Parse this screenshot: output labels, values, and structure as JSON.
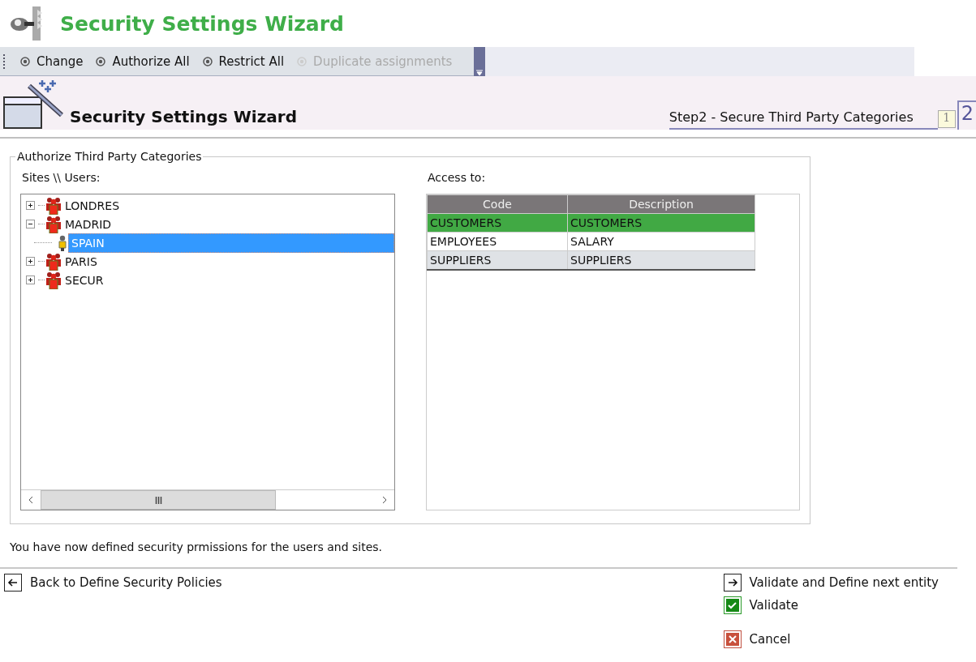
{
  "app_title": "Security Settings Wizard",
  "toolbar": [
    {
      "label": "Change",
      "disabled": false
    },
    {
      "label": "Authorize All",
      "disabled": false
    },
    {
      "label": "Restrict All",
      "disabled": false
    },
    {
      "label": "Duplicate assignments",
      "disabled": true
    }
  ],
  "wizard": {
    "title": "Security Settings Wizard",
    "step_title": "Step2 - Secure Third Party Categories",
    "steps": [
      {
        "label": "1",
        "selected": false
      },
      {
        "label": "2",
        "selected": true
      }
    ]
  },
  "group": {
    "legend": "Authorize Third Party Categories",
    "tree": {
      "label": "Sites \\\\ Users:",
      "items": [
        {
          "label": "LONDRES",
          "kind": "group",
          "expanded": false,
          "selected": false
        },
        {
          "label": "MADRID",
          "kind": "group",
          "expanded": true,
          "selected": false,
          "children": [
            {
              "label": "SPAIN",
              "kind": "user",
              "selected": true
            }
          ]
        },
        {
          "label": "PARIS",
          "kind": "group",
          "expanded": false,
          "selected": false
        },
        {
          "label": "SECUR",
          "kind": "group",
          "expanded": false,
          "selected": false
        }
      ]
    },
    "access": {
      "label": "Access to:",
      "columns": [
        "Code",
        "Description"
      ],
      "rows": [
        {
          "cells": [
            "CUSTOMERS",
            "CUSTOMERS"
          ],
          "selected": true
        },
        {
          "cells": [
            "EMPLOYEES",
            "SALARY"
          ],
          "selected": false
        },
        {
          "cells": [
            "SUPPLIERS",
            "SUPPLIERS"
          ],
          "selected": false
        }
      ]
    }
  },
  "message": "You have now defined security prmissions for the users and sites.",
  "actions": {
    "back": {
      "label": "Back to Define Security Policies",
      "kind": "back"
    },
    "right": [
      {
        "label": "Validate and Define next entity",
        "kind": "next"
      },
      {
        "label": "Validate",
        "kind": "validate"
      },
      {
        "label": "Cancel",
        "kind": "cancel"
      }
    ]
  }
}
